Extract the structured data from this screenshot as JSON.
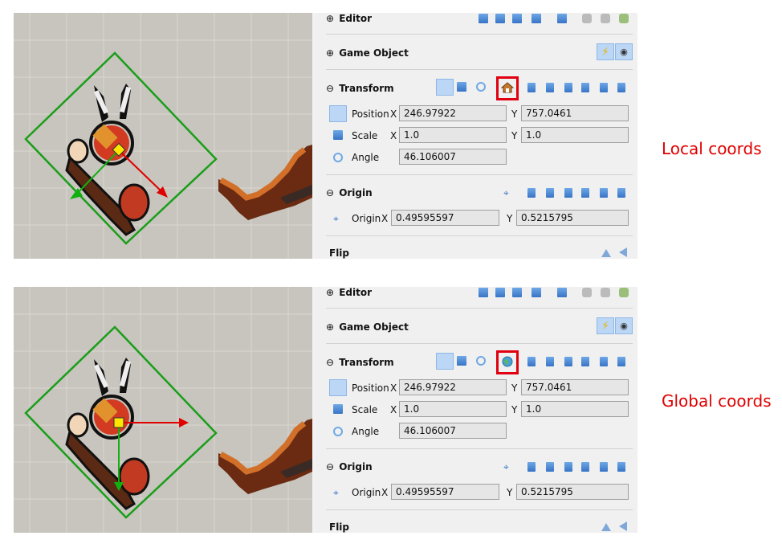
{
  "screenshots": [
    {
      "annotation": "Local coords",
      "active_mode_icon": "home-icon",
      "inspector": {
        "editor_label": "Editor",
        "game_object_label": "Game Object",
        "transform_label": "Transform",
        "position_label": "Position",
        "position_x": "246.97922",
        "position_y": "757.0461",
        "scale_label": "Scale",
        "scale_x": "1.0",
        "scale_y": "1.0",
        "angle_label": "Angle",
        "angle": "46.106007",
        "origin_section_label": "Origin",
        "origin_label": "Origin",
        "origin_x": "0.49595597",
        "origin_y": "0.5215795",
        "flip_label": "Flip",
        "x_label": "X",
        "y_label": "Y"
      }
    },
    {
      "annotation": "Global coords",
      "active_mode_icon": "globe-icon",
      "inspector": {
        "editor_label": "Editor",
        "game_object_label": "Game Object",
        "transform_label": "Transform",
        "position_label": "Position",
        "position_x": "246.97922",
        "position_y": "757.0461",
        "scale_label": "Scale",
        "scale_x": "1.0",
        "scale_y": "1.0",
        "angle_label": "Angle",
        "angle": "46.106007",
        "origin_section_label": "Origin",
        "origin_label": "Origin",
        "origin_x": "0.49595597",
        "origin_y": "0.5215795",
        "flip_label": "Flip",
        "x_label": "X",
        "y_label": "Y"
      }
    }
  ],
  "colors": {
    "canvas": "#c7c5bd",
    "panel": "#f0f0f0",
    "highlight": "#e0000f",
    "annotation": "#e00000",
    "selection_box": "#1a9e1a",
    "gizmo_x": "#e00000",
    "gizmo_y": "#11b011"
  }
}
